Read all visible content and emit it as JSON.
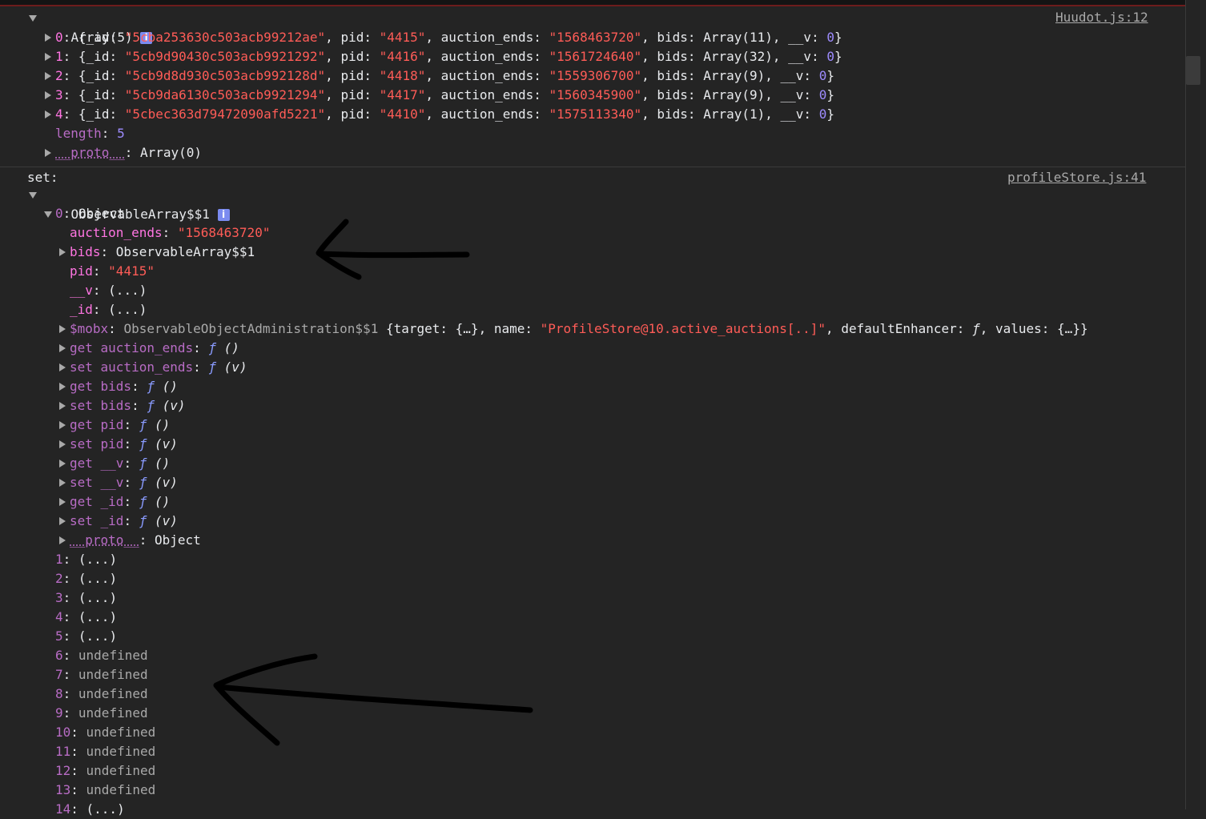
{
  "top_array": {
    "header": "Array(5)",
    "source": "Huudot.js:12",
    "items": [
      {
        "index": "0",
        "id": "\"5cba253630c503acb99212ae\"",
        "pid": "\"4415\"",
        "auction_ends": "\"1568463720\"",
        "bids": "Array(11)",
        "v": "0"
      },
      {
        "index": "1",
        "id": "\"5cb9d90430c503acb9921292\"",
        "pid": "\"4416\"",
        "auction_ends": "\"1561724640\"",
        "bids": "Array(32)",
        "v": "0"
      },
      {
        "index": "2",
        "id": "\"5cb9d8d930c503acb992128d\"",
        "pid": "\"4418\"",
        "auction_ends": "\"1559306700\"",
        "bids": "Array(9)",
        "v": "0"
      },
      {
        "index": "3",
        "id": "\"5cb9da6130c503acb9921294\"",
        "pid": "\"4417\"",
        "auction_ends": "\"1560345900\"",
        "bids": "Array(9)",
        "v": "0"
      },
      {
        "index": "4",
        "id": "\"5cbec363d79472090afd5221\"",
        "pid": "\"4410\"",
        "auction_ends": "\"1575113340\"",
        "bids": "Array(1)",
        "v": "0"
      }
    ],
    "length_key": "length",
    "length_value": "5",
    "proto_key": "__proto__",
    "proto_value": "Array(0)"
  },
  "second_log": {
    "label": "set:",
    "source": "profileStore.js:41",
    "header": "ObservableArray$$1",
    "obj_index": "0",
    "obj_type": "Object",
    "props": {
      "auction_ends_key": "auction_ends",
      "auction_ends_val": "\"1568463720\"",
      "bids_key": "bids",
      "bids_val": "ObservableArray$$1",
      "pid_key": "pid",
      "pid_val": "\"4415\"",
      "v_key": "__v",
      "v_val": "(...)",
      "id_key": "_id",
      "id_val": "(...)"
    },
    "mobx": {
      "key": "$mobx",
      "type": "ObservableObjectAdministration$$1",
      "target_label": "{target: {…}, name: ",
      "name_val": "\"ProfileStore@10.active_auctions[..]\"",
      "rest": ", defaultEnhancer: ",
      "f": "ƒ",
      "values": ", values: {…}}"
    },
    "accessors": [
      {
        "kind": "get",
        "name": "auction_ends",
        "f": "ƒ",
        "args": "()"
      },
      {
        "kind": "set",
        "name": "auction_ends",
        "f": "ƒ",
        "args": "(v)"
      },
      {
        "kind": "get",
        "name": "bids",
        "f": "ƒ",
        "args": "()"
      },
      {
        "kind": "set",
        "name": "bids",
        "f": "ƒ",
        "args": "(v)"
      },
      {
        "kind": "get",
        "name": "pid",
        "f": "ƒ",
        "args": "()"
      },
      {
        "kind": "set",
        "name": "pid",
        "f": "ƒ",
        "args": "(v)"
      },
      {
        "kind": "get",
        "name": "__v",
        "f": "ƒ",
        "args": "()"
      },
      {
        "kind": "set",
        "name": "__v",
        "f": "ƒ",
        "args": "(v)"
      },
      {
        "kind": "get",
        "name": "_id",
        "f": "ƒ",
        "args": "()"
      },
      {
        "kind": "set",
        "name": "_id",
        "f": "ƒ",
        "args": "(v)"
      }
    ],
    "obj_proto_key": "__proto__",
    "obj_proto_val": "Object",
    "entries": [
      {
        "index": "1",
        "value": "(...)"
      },
      {
        "index": "2",
        "value": "(...)"
      },
      {
        "index": "3",
        "value": "(...)"
      },
      {
        "index": "4",
        "value": "(...)"
      },
      {
        "index": "5",
        "value": "(...)"
      },
      {
        "index": "6",
        "value": "undefined"
      },
      {
        "index": "7",
        "value": "undefined"
      },
      {
        "index": "8",
        "value": "undefined"
      },
      {
        "index": "9",
        "value": "undefined"
      },
      {
        "index": "10",
        "value": "undefined"
      },
      {
        "index": "11",
        "value": "undefined"
      },
      {
        "index": "12",
        "value": "undefined"
      },
      {
        "index": "13",
        "value": "undefined"
      },
      {
        "index": "14",
        "value": "(...)"
      }
    ]
  },
  "colors": {
    "background": "#242424",
    "string": "#ff5c57",
    "key": "#ff75e2",
    "number": "#9e8cff",
    "annotation": "#000000"
  }
}
